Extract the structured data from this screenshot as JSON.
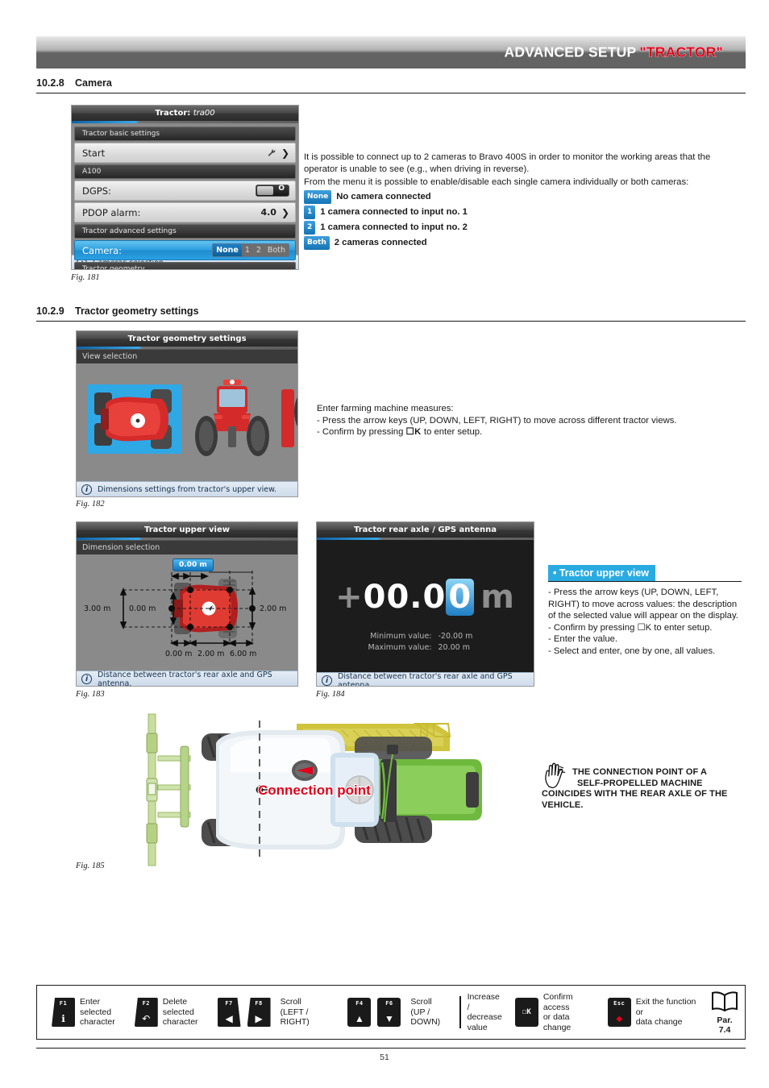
{
  "header": {
    "title_main": "ADVANCED SETUP",
    "title_accent": "\"TRACTOR\""
  },
  "sections": [
    {
      "number": "10.2.8",
      "title": "Camera"
    },
    {
      "number": "10.2.9",
      "title": "Tractor geometry settings"
    }
  ],
  "fig181": {
    "caption": "Fig. 181",
    "screen_title_prefix": "Tractor:",
    "screen_title_value": "tra00",
    "groups": {
      "basic": "Tractor basic settings",
      "a100": "A100",
      "advanced": "Tractor advanced settings",
      "geometry": "Tractor geometry"
    },
    "rows": [
      {
        "label": "Start",
        "value": "",
        "icon": "wrench-icon",
        "chevron": "❯"
      },
      {
        "label": "DGPS:",
        "value": "O",
        "control": "toggle"
      },
      {
        "label": "PDOP alarm:",
        "value": "4.0",
        "chevron": "❯"
      },
      {
        "label": "Camera:",
        "segments": [
          "None",
          "1",
          "2",
          "Both"
        ],
        "selected": "None"
      }
    ],
    "info": "Cameras selection."
  },
  "camera_text": {
    "p1": "It is possible to connect up to 2 cameras to Bravo 400S in order to monitor the working areas that the operator is unable to see (e.g., when driving in reverse).",
    "p2": "From the menu it is possible to enable/disable each single camera individually or both cameras:",
    "options": [
      {
        "badge": "None",
        "label": "No camera connected"
      },
      {
        "badge": "1",
        "label": "1 camera connected to input no. 1"
      },
      {
        "badge": "2",
        "label": "1 camera connected to input no. 2"
      },
      {
        "badge": "Both",
        "label": "2 cameras connected"
      }
    ]
  },
  "fig182": {
    "caption": "Fig. 182",
    "screen_title": "Tractor geometry settings",
    "subheader": "View selection",
    "info": "Dimensions settings from tractor's upper view.",
    "views": [
      "upper-view",
      "rear-view",
      "side-view"
    ],
    "selected_view": "upper-view"
  },
  "geometry_text": {
    "intro": "Enter farming machine measures:",
    "l1": "- Press the arrow keys (UP, DOWN, LEFT, RIGHT) to move across different tractor views.",
    "l2_pre": "- Confirm by pressing ",
    "l2_key": "☐K",
    "l2_post": " to enter setup."
  },
  "fig183": {
    "caption": "Fig. 183",
    "screen_title": "Tractor upper view",
    "subheader": "Dimension selection",
    "info": "Distance between tractor's rear axle and GPS antenna.",
    "highlight_value": "0.00 m",
    "dim_left_outer": "3.00 m",
    "dim_left_inner": "0.00 m",
    "dim_right": "2.00 m",
    "dim_bottom": [
      "0.00 m",
      "2.00 m",
      "6.00 m"
    ]
  },
  "fig184": {
    "caption": "Fig. 184",
    "screen_title": "Tractor rear axle / GPS antenna",
    "info": "Distance between tractor's rear axle and GPS antenna.",
    "value_sign": "+",
    "value_dim": "00.0",
    "value_cursor": "0",
    "value_unit": "m",
    "min_label": "Minimum value:",
    "min_value": "-20.00 m",
    "max_label": "Maximum value:",
    "max_value": "20.00 m"
  },
  "callout": {
    "head": "• Tractor upper view",
    "lines": [
      "- Press the arrow keys (UP, DOWN, LEFT,",
      "RIGHT) to move across values: the description",
      "of the selected value will appear on the display.",
      "- Confirm by pressing ☐K to enter setup.",
      "- Enter the value.",
      "- Select and enter, one by one, all values."
    ]
  },
  "fig185": {
    "caption": "Fig. 185",
    "annotation": "Connection point"
  },
  "warning": {
    "icon": "hand-warning-icon",
    "lines": [
      "THE CONNECTION POINT OF A",
      "SELF-PROPELLED MACHINE",
      "COINCIDES WITH THE REAR AXLE OF THE",
      "VEHICLE."
    ]
  },
  "legend": {
    "items": [
      {
        "keys": [
          {
            "f": "F1",
            "glyph": "ℹ"
          }
        ],
        "text": "Enter\nselected\ncharacter"
      },
      {
        "keys": [
          {
            "f": "F2",
            "glyph": "↶"
          }
        ],
        "text": "Delete\nselected\ncharacter"
      },
      {
        "keys": [
          {
            "f": "F7",
            "glyph": "◀"
          },
          {
            "f": "F8",
            "glyph": "▶"
          }
        ],
        "text": "Scroll\n(LEFT / RIGHT)"
      },
      {
        "keys": [
          {
            "f": "F4",
            "glyph": "▲"
          },
          {
            "f": "F6",
            "glyph": "▼"
          }
        ],
        "text": "Scroll\n(UP / DOWN)"
      }
    ],
    "increase_text": "Increase /\ndecrease\nvalue",
    "ok": {
      "label": "☐K",
      "text": "Confirm access\nor data change"
    },
    "esc": {
      "label": "Esc",
      "text": "Exit the function or\ndata change"
    },
    "par_label": "Par.",
    "par_value": "7.4"
  },
  "footer": {
    "page": "51"
  },
  "colors": {
    "accent_blue": "#29abe2",
    "red": "#e2001a",
    "header_dark": "#636363"
  }
}
